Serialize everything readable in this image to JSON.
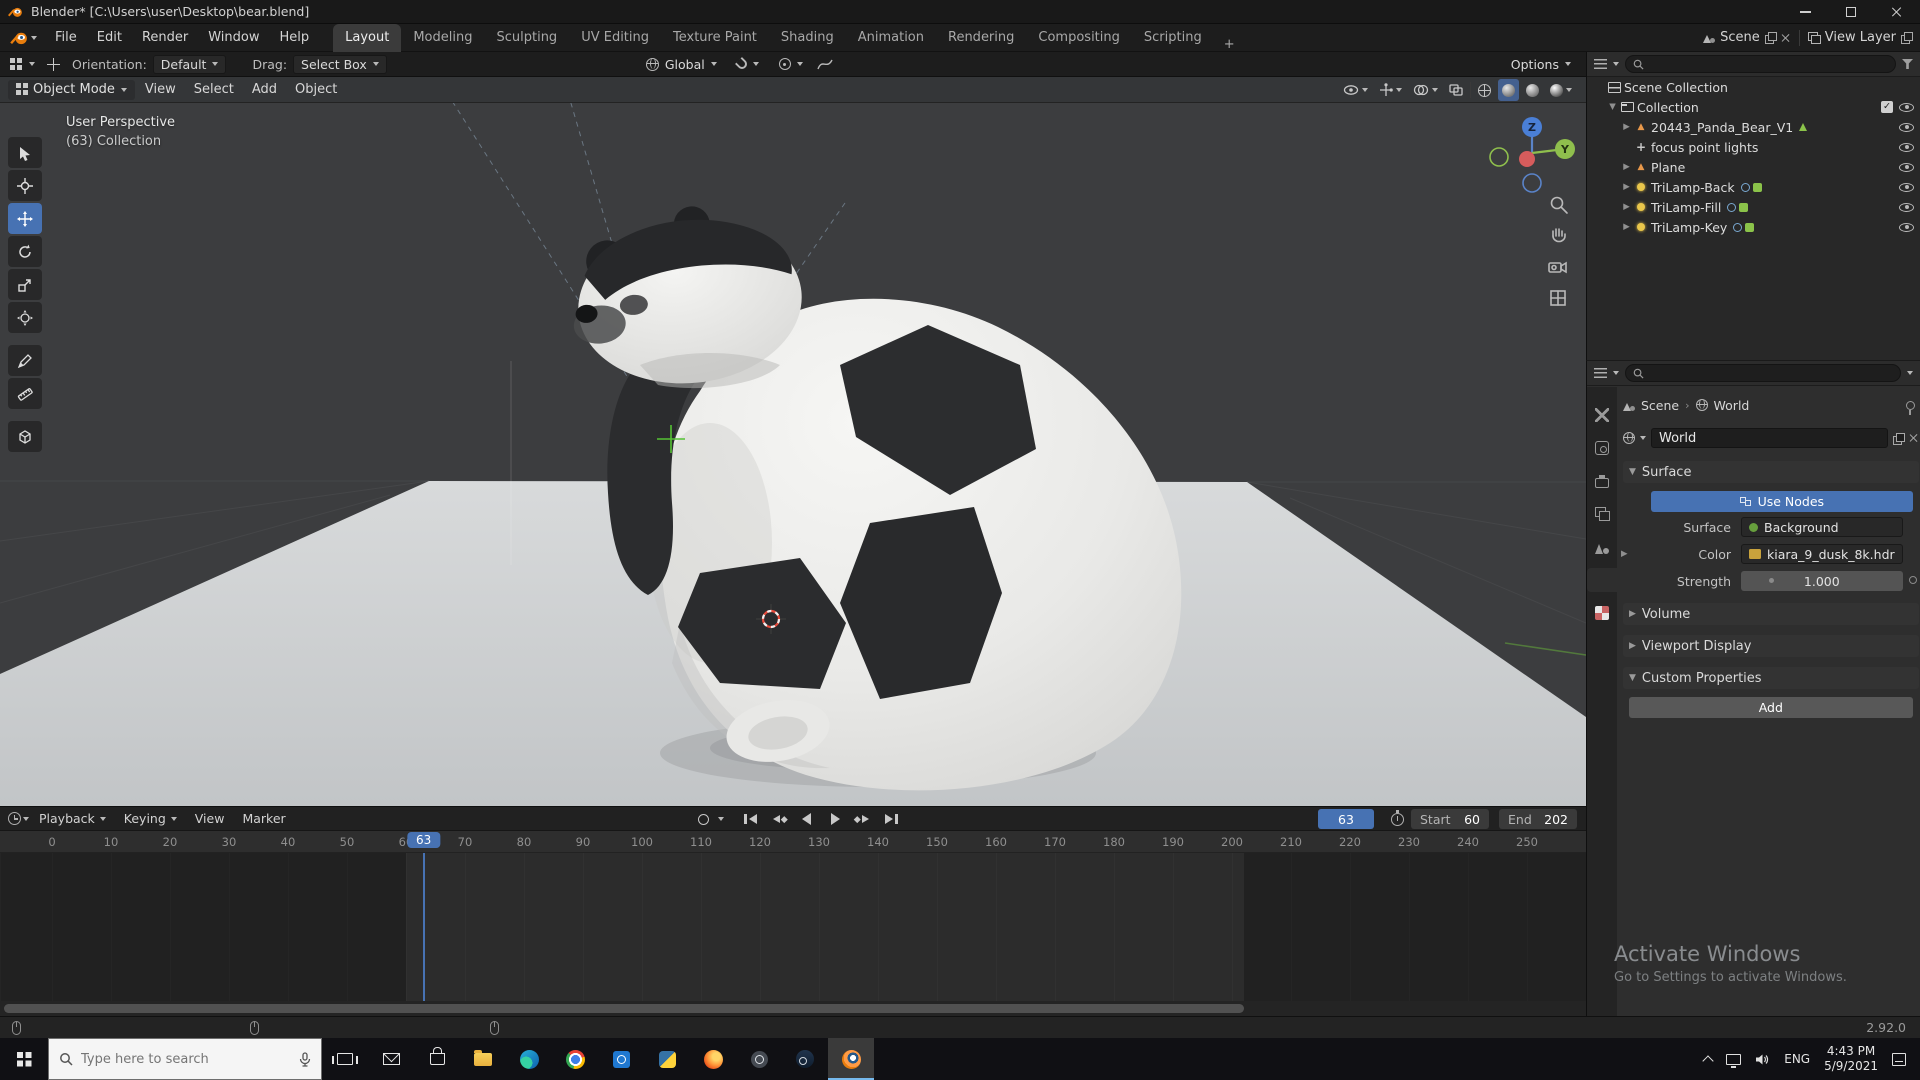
{
  "window": {
    "title": "Blender* [C:\\Users\\user\\Desktop\\bear.blend]"
  },
  "topbar": {
    "menus": [
      "File",
      "Edit",
      "Render",
      "Window",
      "Help"
    ],
    "workspaces": [
      {
        "label": "Layout",
        "active": true
      },
      {
        "label": "Modeling"
      },
      {
        "label": "Sculpting"
      },
      {
        "label": "UV Editing"
      },
      {
        "label": "Texture Paint"
      },
      {
        "label": "Shading"
      },
      {
        "label": "Animation"
      },
      {
        "label": "Rendering"
      },
      {
        "label": "Compositing"
      },
      {
        "label": "Scripting"
      }
    ],
    "add_workspace": "+",
    "scene_selector": {
      "label": "Scene"
    },
    "view_layer_selector": {
      "label": "View Layer"
    }
  },
  "tool_settings": {
    "orientation_label": "Orientation:",
    "orientation_value": "Default",
    "drag_label": "Drag:",
    "drag_value": "Select Box",
    "transform_orientation": "Global",
    "options_label": "Options"
  },
  "viewport": {
    "mode": "Object Mode",
    "menus": [
      {
        "label": "View"
      },
      {
        "label": "Select"
      },
      {
        "label": "Add"
      },
      {
        "label": "Object"
      }
    ],
    "overlay": {
      "line1": "User Perspective",
      "line2": "(63) Collection"
    },
    "gizmo": {
      "z": "Z",
      "y": "Y"
    }
  },
  "outliner": {
    "search_placeholder": "",
    "rows": [
      {
        "arrow": "",
        "indent": 0,
        "icon": "scene-collection",
        "label": "Scene Collection",
        "check": false,
        "eye": false,
        "badges": []
      },
      {
        "arrow": "▼",
        "indent": 1,
        "icon": "collection",
        "label": "Collection",
        "check": true,
        "eye": true,
        "badges": []
      },
      {
        "arrow": "▶",
        "indent": 2,
        "icon": "mesh",
        "label": "20443_Panda_Bear_V1",
        "check": false,
        "eye": true,
        "badges": [
          "mesh-data"
        ]
      },
      {
        "arrow": "",
        "indent": 2,
        "icon": "empty",
        "label": "focus point lights",
        "check": false,
        "eye": true,
        "badges": []
      },
      {
        "arrow": "▶",
        "indent": 2,
        "icon": "mesh",
        "label": "Plane",
        "check": false,
        "eye": true,
        "badges": []
      },
      {
        "arrow": "▶",
        "indent": 2,
        "icon": "light",
        "label": "TriLamp-Back",
        "check": false,
        "eye": true,
        "badges": [
          "constraint",
          "light-data"
        ]
      },
      {
        "arrow": "▶",
        "indent": 2,
        "icon": "light",
        "label": "TriLamp-Fill",
        "check": false,
        "eye": true,
        "badges": [
          "constraint",
          "light-data"
        ]
      },
      {
        "arrow": "▶",
        "indent": 2,
        "icon": "light",
        "label": "TriLamp-Key",
        "check": false,
        "eye": true,
        "badges": [
          "constraint",
          "light-data"
        ]
      }
    ]
  },
  "properties": {
    "search_placeholder": "",
    "tabs": [
      {
        "id": "tool"
      },
      {
        "id": "render"
      },
      {
        "id": "output"
      },
      {
        "id": "view-layer"
      },
      {
        "id": "scene"
      },
      {
        "id": "world",
        "active": true
      },
      {
        "id": "texture"
      }
    ],
    "breadcrumb": {
      "scene": "Scene",
      "world": "World"
    },
    "world_name": "World",
    "surface_panel": {
      "title": "Surface",
      "use_nodes": "Use Nodes",
      "surface_label": "Surface",
      "surface_value": "Background",
      "color_label": "Color",
      "color_value": "kiara_9_dusk_8k.hdr",
      "strength_label": "Strength",
      "strength_value": "1.000"
    },
    "volume_panel": "Volume",
    "viewport_display_panel": "Viewport Display",
    "custom_properties_panel": "Custom Properties",
    "add_button": "Add"
  },
  "timeline": {
    "menus": [
      {
        "label": "Playback",
        "caret": true
      },
      {
        "label": "Keying",
        "caret": true
      },
      {
        "label": "View"
      },
      {
        "label": "Marker"
      }
    ],
    "transport": [
      {
        "id": "jump-start"
      },
      {
        "id": "prev-key"
      },
      {
        "id": "play-back"
      },
      {
        "id": "play"
      },
      {
        "id": "next-key"
      },
      {
        "id": "jump-end"
      }
    ],
    "current_frame": "63",
    "start_label": "Start",
    "start_value": "60",
    "end_label": "End",
    "end_value": "202",
    "ticks": [
      0,
      10,
      20,
      30,
      40,
      50,
      60,
      70,
      80,
      90,
      100,
      110,
      120,
      130,
      140,
      150,
      160,
      170,
      180,
      190,
      200,
      210,
      220,
      230,
      240,
      250
    ]
  },
  "statusbar": {
    "version": "2.92.0"
  },
  "watermark": {
    "title": "Activate Windows",
    "subtitle": "Go to Settings to activate Windows."
  },
  "taskbar": {
    "search_placeholder": "Type here to search",
    "apps": [
      {
        "id": "task-view"
      },
      {
        "id": "mail"
      },
      {
        "id": "store"
      },
      {
        "id": "file-explorer"
      },
      {
        "id": "edge"
      },
      {
        "id": "chrome"
      },
      {
        "id": "photos"
      },
      {
        "id": "python"
      },
      {
        "id": "firefox"
      },
      {
        "id": "app-dark"
      },
      {
        "id": "steam"
      },
      {
        "id": "blender",
        "active": true
      }
    ],
    "tray": {
      "lang": "ENG",
      "time": "4:43 PM",
      "date": "5/9/2021"
    }
  }
}
